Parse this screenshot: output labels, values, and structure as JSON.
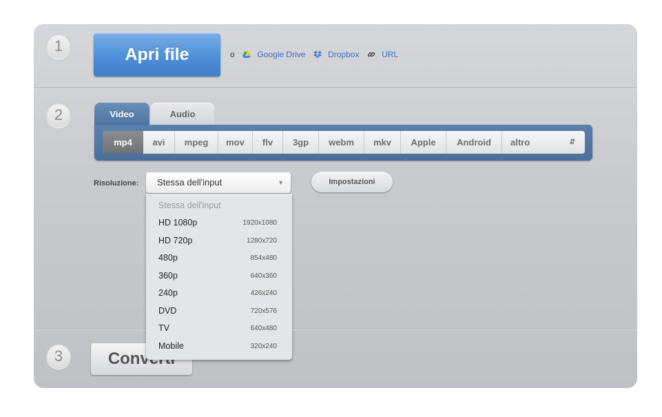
{
  "step1": {
    "number": "1",
    "open_label": "Apri file",
    "or_label": "o",
    "sources": [
      {
        "label": "Google Drive",
        "icon": "google-drive-icon"
      },
      {
        "label": "Dropbox",
        "icon": "dropbox-icon"
      },
      {
        "label": "URL",
        "icon": "link-icon"
      }
    ]
  },
  "step2": {
    "number": "2",
    "tabs": [
      {
        "label": "Video"
      },
      {
        "label": "Audio"
      }
    ],
    "formats": [
      "mp4",
      "avi",
      "mpeg",
      "mov",
      "flv",
      "3gp",
      "webm",
      "mkv",
      "Apple",
      "Android",
      "altro"
    ],
    "selected_format": "mp4",
    "resolution_label": "Risoluzione:",
    "resolution_value": "Stessa dell'input",
    "settings_label": "Impostazioni",
    "resolution_options": [
      {
        "name": "Stessa dell'input",
        "size": ""
      },
      {
        "name": "HD 1080p",
        "size": "1920x1080"
      },
      {
        "name": "HD 720p",
        "size": "1280x720"
      },
      {
        "name": "480p",
        "size": "854x480"
      },
      {
        "name": "360p",
        "size": "640x360"
      },
      {
        "name": "240p",
        "size": "426x240"
      },
      {
        "name": "DVD",
        "size": "720x576"
      },
      {
        "name": "TV",
        "size": "640x480"
      },
      {
        "name": "Mobile",
        "size": "320x240"
      }
    ]
  },
  "step3": {
    "number": "3",
    "convert_label": "Converti"
  },
  "colors": {
    "accent_blue": "#4f8fd8",
    "tab_blue": "#4b72a0",
    "panel_gray": "#c9cbcf"
  }
}
